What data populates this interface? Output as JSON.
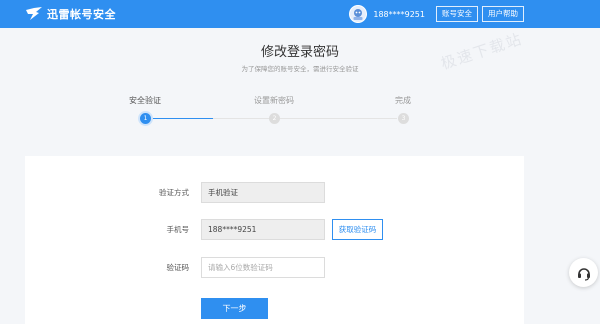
{
  "header": {
    "logo_text": "迅雷帐号安全",
    "brand_color": "#2f8ff0",
    "avatar_icon": "avatar-icon",
    "phone": "188****9251",
    "buttons": [
      "账号安全",
      "用户帮助"
    ]
  },
  "page": {
    "title": "修改登录密码",
    "subtitle": "为了保障您的账号安全，需进行安全验证",
    "watermark": "极速下载站"
  },
  "steps": [
    {
      "label": "安全验证",
      "number": "1",
      "active": true
    },
    {
      "label": "设置新密码",
      "number": "2",
      "active": false
    },
    {
      "label": "完成",
      "number": "3",
      "active": false
    }
  ],
  "form": {
    "method_label": "验证方式",
    "method_value": "手机验证",
    "phone_label": "手机号",
    "phone_value": "188****9251",
    "get_code_label": "获取验证码",
    "code_label": "验证码",
    "code_placeholder": "请输入6位数验证码",
    "next_label": "下一步"
  },
  "support": {
    "icon": "headset-icon"
  }
}
